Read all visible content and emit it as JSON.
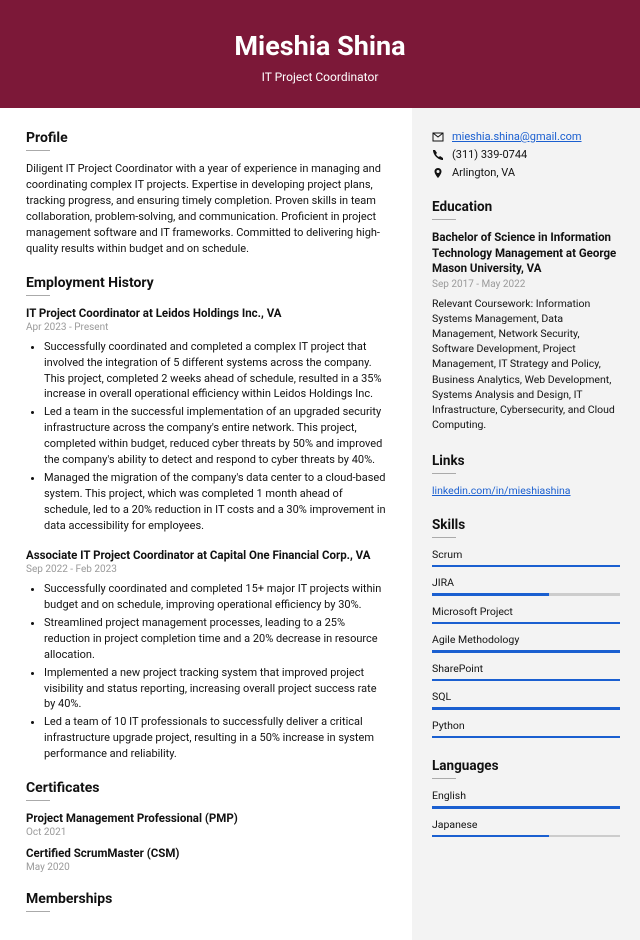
{
  "header": {
    "name": "Mieshia Shina",
    "title": "IT Project Coordinator"
  },
  "profile": {
    "heading": "Profile",
    "text": "Diligent IT Project Coordinator with a year of experience in managing and coordinating complex IT projects. Expertise in developing project plans, tracking progress, and ensuring timely completion. Proven skills in team collaboration, problem-solving, and communication. Proficient in project management software and IT frameworks. Committed to delivering high-quality results within budget and on schedule."
  },
  "employment": {
    "heading": "Employment History",
    "jobs": [
      {
        "title": "IT Project Coordinator at Leidos Holdings Inc., VA",
        "dates": "Apr 2023 - Present",
        "bullets": [
          "Successfully coordinated and completed a complex IT project that involved the integration of 5 different systems across the company. This project, completed 2 weeks ahead of schedule, resulted in a 35% increase in overall operational efficiency within Leidos Holdings Inc.",
          "Led a team in the successful implementation of an upgraded security infrastructure across the company's entire network. This project, completed within budget, reduced cyber threats by 50% and improved the company's ability to detect and respond to cyber threats by 40%.",
          "Managed the migration of the company's data center to a cloud-based system. This project, which was completed 1 month ahead of schedule, led to a 20% reduction in IT costs and a 30% improvement in data accessibility for employees."
        ]
      },
      {
        "title": "Associate IT Project Coordinator at Capital One Financial Corp., VA",
        "dates": "Sep 2022 - Feb 2023",
        "bullets": [
          "Successfully coordinated and completed 15+ major IT projects within budget and on schedule, improving operational efficiency by 30%.",
          "Streamlined project management processes, leading to a 25% reduction in project completion time and a 20% decrease in resource allocation.",
          "Implemented a new project tracking system that improved project visibility and status reporting, increasing overall project success rate by 40%.",
          "Led a team of 10 IT professionals to successfully deliver a critical infrastructure upgrade project, resulting in a 50% increase in system performance and reliability."
        ]
      }
    ]
  },
  "certificates": {
    "heading": "Certificates",
    "items": [
      {
        "title": "Project Management Professional (PMP)",
        "date": "Oct 2021"
      },
      {
        "title": "Certified ScrumMaster (CSM)",
        "date": "May 2020"
      }
    ]
  },
  "memberships": {
    "heading": "Memberships"
  },
  "contact": {
    "email": "mieshia.shina@gmail.com",
    "phone": "(311) 339-0744",
    "location": "Arlington, VA"
  },
  "education": {
    "heading": "Education",
    "title": "Bachelor of Science in Information Technology Management at George Mason University, VA",
    "dates": "Sep 2017 - May 2022",
    "text": "Relevant Coursework: Information Systems Management, Data Management, Network Security, Software Development, Project Management, IT Strategy and Policy, Business Analytics, Web Development, Systems Analysis and Design, IT Infrastructure, Cybersecurity, and Cloud Computing."
  },
  "links": {
    "heading": "Links",
    "url": "linkedin.com/in/mieshiashina"
  },
  "skills": {
    "heading": "Skills",
    "items": [
      {
        "name": "Scrum",
        "pct": 100
      },
      {
        "name": "JIRA",
        "pct": 62
      },
      {
        "name": "Microsoft Project",
        "pct": 100
      },
      {
        "name": "Agile Methodology",
        "pct": 100
      },
      {
        "name": "SharePoint",
        "pct": 100
      },
      {
        "name": "SQL",
        "pct": 100
      },
      {
        "name": "Python",
        "pct": 100
      }
    ]
  },
  "languages": {
    "heading": "Languages",
    "items": [
      {
        "name": "English",
        "pct": 100
      },
      {
        "name": "Japanese",
        "pct": 62
      }
    ]
  }
}
